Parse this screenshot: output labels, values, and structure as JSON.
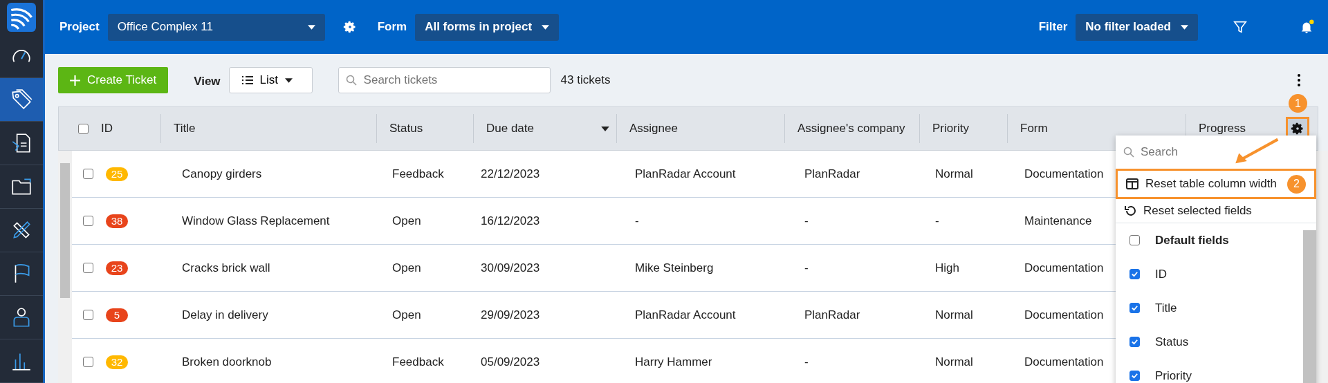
{
  "sidebar": {
    "items": [
      {
        "selected": false
      },
      {
        "selected": true
      },
      {
        "selected": false
      },
      {
        "selected": false
      },
      {
        "selected": false
      },
      {
        "selected": false
      },
      {
        "selected": false
      },
      {
        "selected": false
      }
    ]
  },
  "topbar": {
    "project_label": "Project",
    "project_value": "Office Complex 11",
    "form_label": "Form",
    "form_value": "All forms in project",
    "filter_label": "Filter",
    "filter_value": "No filter loaded",
    "unread_notifications": true
  },
  "toolbar": {
    "create_button": "Create Ticket",
    "view_label": "View",
    "view_value": "List",
    "search": {
      "placeholder": "Search tickets"
    },
    "ticket_count": "43 tickets"
  },
  "table": {
    "header_checked": false,
    "columns": [
      {
        "label": "ID",
        "sorted": false
      },
      {
        "label": "Title",
        "sorted": false
      },
      {
        "label": "Status",
        "sorted": false
      },
      {
        "label": "Due date",
        "sorted": true
      },
      {
        "label": "Assignee",
        "sorted": false
      },
      {
        "label": "Assignee's company",
        "sorted": false
      },
      {
        "label": "Priority",
        "sorted": false
      },
      {
        "label": "Form",
        "sorted": false
      },
      {
        "label": "Progress",
        "sorted": false
      }
    ],
    "settings_annotation": "1",
    "rows": [
      {
        "checked": false,
        "id": "25",
        "color": "#ffb800",
        "title": "Canopy girders",
        "status": "Feedback",
        "due_date": "22/12/2023",
        "assignee": "PlanRadar Account",
        "company": "PlanRadar",
        "priority": "Normal",
        "form": "Documentation"
      },
      {
        "checked": false,
        "id": "38",
        "color": "#e8441b",
        "title": "Window Glass Replacement",
        "status": "Open",
        "due_date": "16/12/2023",
        "assignee": "-",
        "company": "-",
        "priority": "-",
        "form": "Maintenance"
      },
      {
        "checked": false,
        "id": "23",
        "color": "#e8441b",
        "title": "Cracks brick wall",
        "status": "Open",
        "due_date": "30/09/2023",
        "assignee": "Mike Steinberg",
        "company": "-",
        "priority": "High",
        "form": "Documentation"
      },
      {
        "checked": false,
        "id": "5",
        "color": "#e8441b",
        "title": "Delay in delivery",
        "status": "Open",
        "due_date": "29/09/2023",
        "assignee": "PlanRadar Account",
        "company": "PlanRadar",
        "priority": "Normal",
        "form": "Documentation"
      },
      {
        "checked": false,
        "id": "32",
        "color": "#ffb800",
        "title": "Broken doorknob",
        "status": "Feedback",
        "due_date": "05/09/2023",
        "assignee": "Harry Hammer",
        "company": "-",
        "priority": "Normal",
        "form": "Documentation"
      }
    ]
  },
  "column_menu": {
    "search": {
      "placeholder": "Search"
    },
    "actions": [
      {
        "kind": "columns",
        "label": "Reset table column width",
        "highlighted": true,
        "annotation": "2"
      },
      {
        "kind": "undo",
        "label": "Reset selected fields",
        "highlighted": false
      }
    ],
    "fields": [
      {
        "kind": "group",
        "label": "Default fields",
        "checked": false
      },
      {
        "kind": "field",
        "label": "ID",
        "checked": true
      },
      {
        "kind": "field",
        "label": "Title",
        "checked": true
      },
      {
        "kind": "field",
        "label": "Status",
        "checked": true
      },
      {
        "kind": "field",
        "label": "Priority",
        "checked": true
      }
    ]
  }
}
